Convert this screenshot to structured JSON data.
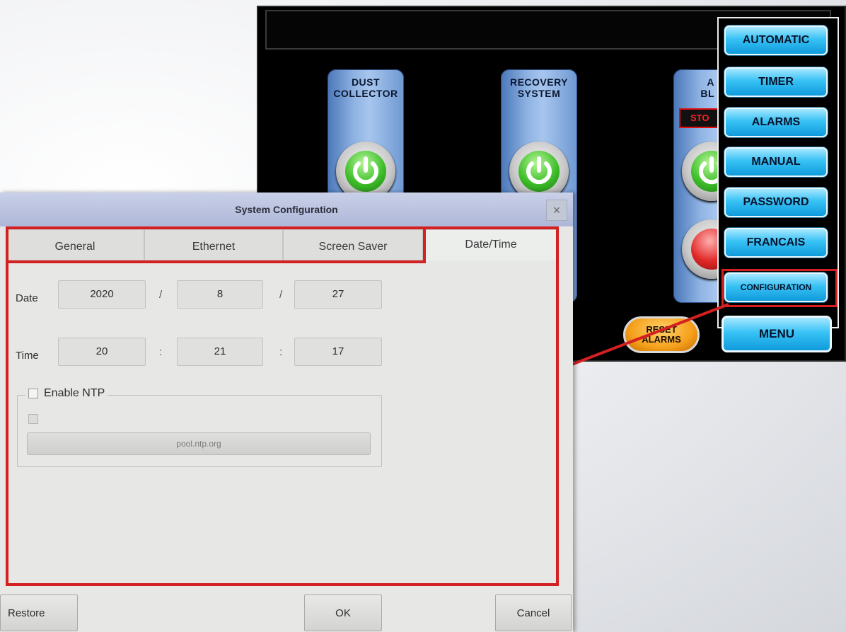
{
  "hmi": {
    "cards": [
      {
        "title": "DUST\nCOLLECTOR"
      },
      {
        "title": "RECOVERY\nSYSTEM"
      },
      {
        "title": "A\nBL",
        "status": "STO"
      }
    ],
    "reset_button": "RESET\nALARMS"
  },
  "menu": {
    "items": [
      "AUTOMATIC",
      "TIMER",
      "ALARMS",
      "MANUAL",
      "PASSWORD",
      "FRANCAIS",
      "CONFIGURATION"
    ],
    "main_button": "MENU",
    "highlighted_item": "CONFIGURATION"
  },
  "dialog": {
    "title": "System Configuration",
    "close": "×",
    "tabs": [
      "General",
      "Ethernet",
      "Screen Saver",
      "Date/Time"
    ],
    "active_tab": "Date/Time",
    "date": {
      "label": "Date",
      "year": "2020",
      "month": "8",
      "day": "27",
      "sep": "/"
    },
    "time": {
      "label": "Time",
      "hour": "20",
      "minute": "21",
      "second": "17",
      "sep": ":"
    },
    "ntp": {
      "label": "Enable NTP",
      "server": "pool.ntp.org"
    },
    "buttons": {
      "restore": "Restore",
      "ok": "OK",
      "cancel": "Cancel"
    }
  },
  "colors": {
    "highlight": "#d42020",
    "menu_button": "#38c2f5",
    "reset_button": "#f5a01c"
  }
}
